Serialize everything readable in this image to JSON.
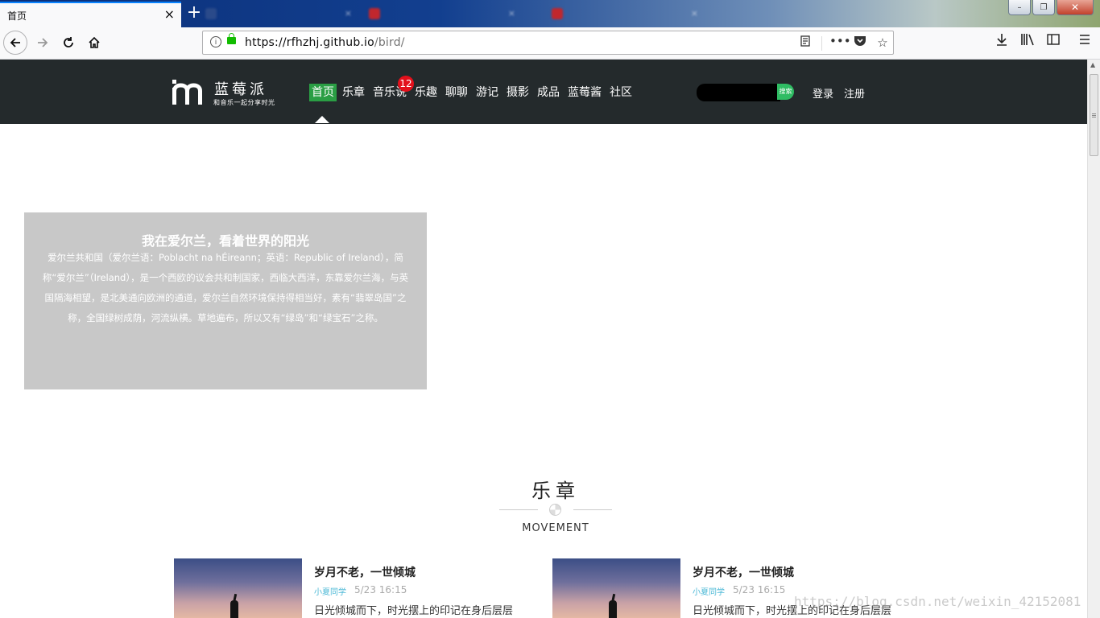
{
  "browser": {
    "active_tab_title": "首页",
    "tab_close": "×",
    "new_tab": "+",
    "background_tabs": [
      {
        "title": "",
        "color": "#2a4a8a"
      },
      {
        "title": "",
        "color": "#c1272d"
      },
      {
        "title": "",
        "color": "#c1272d"
      }
    ],
    "url_host": "https://rfhzhj.github.io",
    "url_path": "/bird/",
    "window_controls": {
      "minimize": "–",
      "maximize": "❐",
      "close": "✕"
    }
  },
  "site": {
    "logo_cn": "蓝莓派",
    "logo_slogan": "和音乐一起分享时光",
    "nav": [
      {
        "label": "首页",
        "active": true
      },
      {
        "label": "乐章"
      },
      {
        "label": "音乐说",
        "badge": "12"
      },
      {
        "label": "乐趣"
      },
      {
        "label": "聊聊"
      },
      {
        "label": "游记"
      },
      {
        "label": "摄影"
      },
      {
        "label": "成品"
      },
      {
        "label": "蓝莓酱"
      },
      {
        "label": "社区"
      }
    ],
    "search_button": "搜索",
    "login": "登录",
    "register": "注册",
    "accent_color": "#2a9e44",
    "header_bg": "#242a2c"
  },
  "banner": {
    "title": "我在爱尔兰，看着世界的阳光",
    "text": "爱尔兰共和国（爱尔兰语：Poblacht na hÉireann；英语：Republic of Ireland），简称“爱尔兰”（Ireland），是一个西欧的议会共和制国家，西临大西洋，东靠爱尔兰海，与英国隔海相望，是北美通向欧洲的通道，爱尔兰自然环境保持得相当好，素有“翡翠岛国”之称，全国绿树成荫，河流纵横。草地遍布，所以又有“绿岛”和“绿宝石”之称。"
  },
  "section": {
    "title": "乐章",
    "subtitle": "MOVEMENT"
  },
  "articles": [
    {
      "title": "岁月不老，一世倾城",
      "author": "小夏同学",
      "date": "5/23  16:15",
      "excerpt": "日光倾城而下，时光摆上的印记在身后层层"
    },
    {
      "title": "岁月不老，一世倾城",
      "author": "小夏同学",
      "date": "5/23  16:15",
      "excerpt": "日光倾城而下，时光摆上的印记在身后层层"
    }
  ],
  "watermark": "https://blog.csdn.net/weixin_42152081"
}
